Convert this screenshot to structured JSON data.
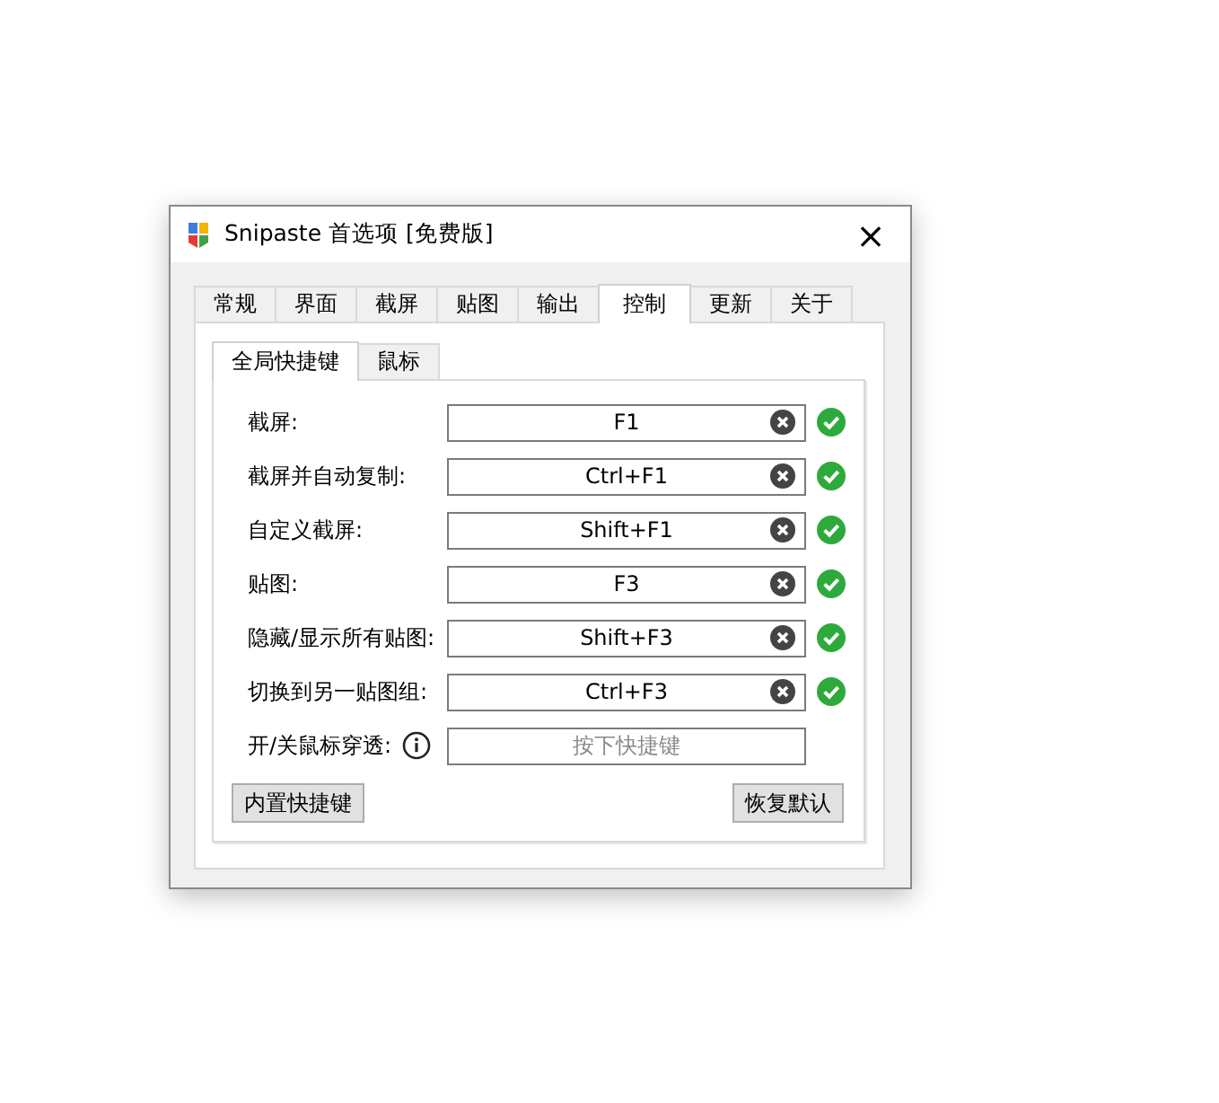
{
  "window": {
    "title": "Snipaste 首选项 [免费版]",
    "close": "×"
  },
  "tabs": [
    {
      "label": "常规",
      "selected": false
    },
    {
      "label": "界面",
      "selected": false
    },
    {
      "label": "截屏",
      "selected": false
    },
    {
      "label": "贴图",
      "selected": false
    },
    {
      "label": "输出",
      "selected": false
    },
    {
      "label": "控制",
      "selected": true
    },
    {
      "label": "更新",
      "selected": false
    },
    {
      "label": "关于",
      "selected": false
    }
  ],
  "subtabs": [
    {
      "label": "全局快捷键",
      "selected": true
    },
    {
      "label": "鼠标",
      "selected": false
    }
  ],
  "shortcuts": [
    {
      "label": "截屏:",
      "value": "F1",
      "valid": true
    },
    {
      "label": "截屏并自动复制:",
      "value": "Ctrl+F1",
      "valid": true
    },
    {
      "label": "自定义截屏:",
      "value": "Shift+F1",
      "valid": true
    },
    {
      "label": "贴图:",
      "value": "F3",
      "valid": true
    },
    {
      "label": "隐藏/显示所有贴图:",
      "value": "Shift+F3",
      "valid": true
    },
    {
      "label": "切换到另一贴图组:",
      "value": "Ctrl+F3",
      "valid": true
    },
    {
      "label": "开/关鼠标穿透:",
      "placeholder": "按下快捷键",
      "info": true,
      "valid": false
    }
  ],
  "buttons": {
    "left": "内置快捷键",
    "right": "恢复默认"
  }
}
